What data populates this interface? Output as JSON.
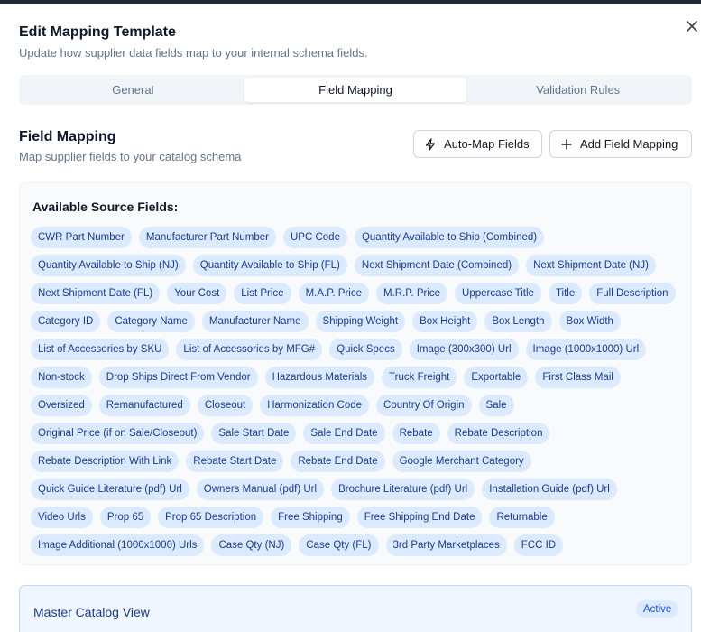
{
  "dialog": {
    "title": "Edit Mapping Template",
    "subtitle": "Update how supplier data fields map to your internal schema fields.",
    "close_icon": "close-icon"
  },
  "tabs": [
    {
      "label": "General",
      "active": false
    },
    {
      "label": "Field Mapping",
      "active": true
    },
    {
      "label": "Validation Rules",
      "active": false
    }
  ],
  "field_mapping": {
    "title": "Field Mapping",
    "subtitle": "Map supplier fields to your catalog schema",
    "auto_map_label": "Auto-Map Fields",
    "auto_map_icon": "lightning-icon",
    "add_label": "Add Field Mapping",
    "add_icon": "plus-icon"
  },
  "available_fields": {
    "label": "Available Source Fields:",
    "chip_color": "#dbeafe",
    "chip_text_color": "#1e3a8a",
    "items": [
      "CWR Part Number",
      "Manufacturer Part Number",
      "UPC Code",
      "Quantity Available to Ship (Combined)",
      "Quantity Available to Ship (NJ)",
      "Quantity Available to Ship (FL)",
      "Next Shipment Date (Combined)",
      "Next Shipment Date (NJ)",
      "Next Shipment Date (FL)",
      "Your Cost",
      "List Price",
      "M.A.P. Price",
      "M.R.P. Price",
      "Uppercase Title",
      "Title",
      "Full Description",
      "Category ID",
      "Category Name",
      "Manufacturer Name",
      "Shipping Weight",
      "Box Height",
      "Box Length",
      "Box Width",
      "List of Accessories by SKU",
      "List of Accessories by MFG#",
      "Quick Specs",
      "Image (300x300) Url",
      "Image (1000x1000) Url",
      "Non-stock",
      "Drop Ships Direct From Vendor",
      "Hazardous Materials",
      "Truck Freight",
      "Exportable",
      "First Class Mail",
      "Oversized",
      "Remanufactured",
      "Closeout",
      "Harmonization Code",
      "Country Of Origin",
      "Sale",
      "Original Price (if on Sale/Closeout)",
      "Sale Start Date",
      "Sale End Date",
      "Rebate",
      "Rebate Description",
      "Rebate Description With Link",
      "Rebate Start Date",
      "Rebate End Date",
      "Google Merchant Category",
      "Quick Guide Literature (pdf) Url",
      "Owners Manual (pdf) Url",
      "Brochure Literature (pdf) Url",
      "Installation Guide (pdf) Url",
      "Video Urls",
      "Prop 65",
      "Prop 65 Description",
      "Free Shipping",
      "Free Shipping End Date",
      "Returnable",
      "Image Additional (1000x1000) Urls",
      "Case Qty (NJ)",
      "Case Qty (FL)",
      "3rd Party Marketplaces",
      "FCC ID"
    ]
  },
  "master_catalog": {
    "title": "Master Catalog View",
    "badge": "Active"
  },
  "colors": {
    "accent": "#1d4ed8",
    "tab_bg": "#f1f5f9",
    "panel_bg": "#f8fafc",
    "master_bg": "#eff6ff"
  }
}
